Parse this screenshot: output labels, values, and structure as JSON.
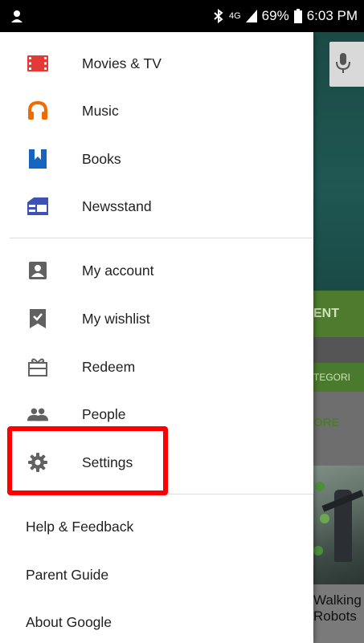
{
  "status_bar": {
    "network": "4G",
    "battery": "69%",
    "time": "6:03 PM"
  },
  "drawer": {
    "apps": [
      {
        "label": "Movies & TV",
        "icon": "movies-tv-icon",
        "color": "#e53935"
      },
      {
        "label": "Music",
        "icon": "music-icon",
        "color": "#ef6c00"
      },
      {
        "label": "Books",
        "icon": "books-icon",
        "color": "#1565c0"
      },
      {
        "label": "Newsstand",
        "icon": "newsstand-icon",
        "color": "#3f51b5"
      }
    ],
    "account": [
      {
        "label": "My account",
        "icon": "account-icon"
      },
      {
        "label": "My wishlist",
        "icon": "wishlist-icon"
      },
      {
        "label": "Redeem",
        "icon": "redeem-icon"
      },
      {
        "label": "People",
        "icon": "people-icon"
      },
      {
        "label": "Settings",
        "icon": "settings-icon"
      }
    ],
    "footer": [
      {
        "label": "Help & Feedback"
      },
      {
        "label": "Parent Guide"
      },
      {
        "label": "About Google"
      }
    ]
  },
  "background": {
    "button_fragment": "ENT",
    "tab_fragment": "TEGORI",
    "more_fragment": "ORE",
    "caption_line1": "Walking",
    "caption_line2": "Robots"
  },
  "highlight_color": "#ff0000"
}
